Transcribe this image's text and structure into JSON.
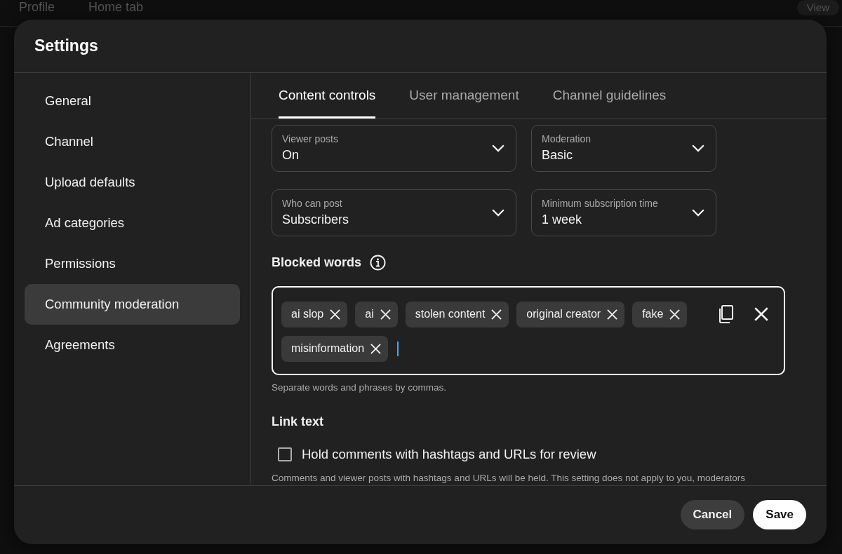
{
  "background": {
    "tabs": [
      "Profile",
      "Home tab"
    ],
    "view_button": "View"
  },
  "dialog": {
    "title": "Settings"
  },
  "sidebar": {
    "items": [
      {
        "label": "General",
        "selected": false
      },
      {
        "label": "Channel",
        "selected": false
      },
      {
        "label": "Upload defaults",
        "selected": false
      },
      {
        "label": "Ad categories",
        "selected": false
      },
      {
        "label": "Permissions",
        "selected": false
      },
      {
        "label": "Community moderation",
        "selected": true
      },
      {
        "label": "Agreements",
        "selected": false
      }
    ]
  },
  "tabs": [
    {
      "label": "Content controls",
      "selected": true
    },
    {
      "label": "User management",
      "selected": false
    },
    {
      "label": "Channel guidelines",
      "selected": false
    }
  ],
  "dropdowns": [
    {
      "label": "Viewer posts",
      "value": "On"
    },
    {
      "label": "Moderation",
      "value": "Basic"
    },
    {
      "label": "Who can post",
      "value": "Subscribers"
    },
    {
      "label": "Minimum subscription time",
      "value": "1 week"
    }
  ],
  "blocked_words": {
    "title": "Blocked words",
    "focused": true,
    "tags": [
      "ai slop",
      "ai",
      "stolen content",
      "original creator",
      "fake",
      "misinformation"
    ],
    "helper": "Separate words and phrases by commas."
  },
  "link_text": {
    "title": "Link text",
    "checkbox": {
      "label": "Hold comments with hashtags and URLs for review",
      "checked": false
    },
    "description": "Comments and viewer posts with hashtags and URLs will be held. This setting does not apply to you, moderators"
  },
  "buttons": [
    {
      "label": "Cancel",
      "kind": "secondary"
    },
    {
      "label": "Save",
      "kind": "primary"
    }
  ]
}
